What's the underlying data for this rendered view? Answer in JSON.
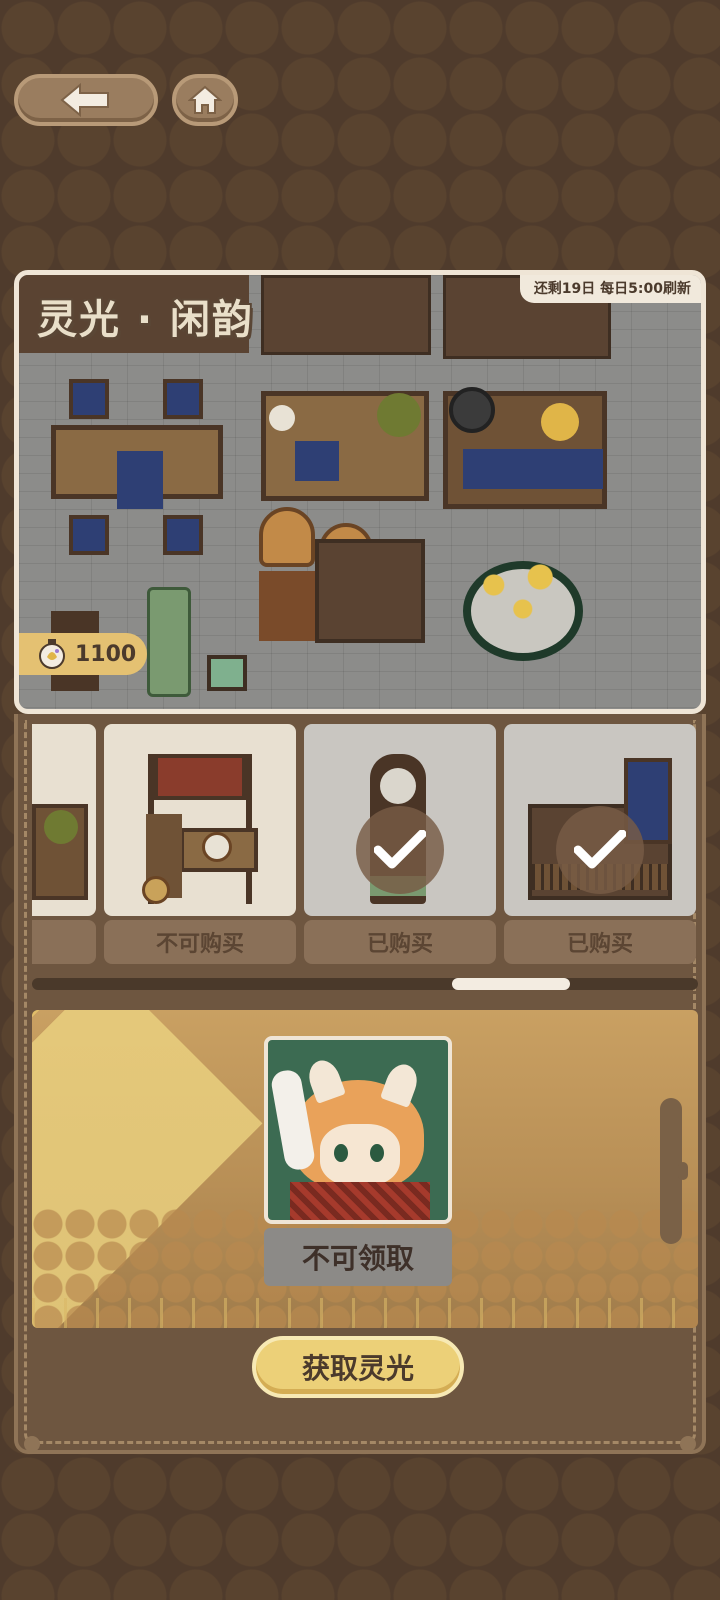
{
  "nav": {
    "back_icon": "arrow-left-icon",
    "home_icon": "home-icon"
  },
  "banner": {
    "title": "灵光 · 闲韵",
    "refresh_text": "还剩19日 每日5:00刷新",
    "currency_icon": "lantern-icon",
    "currency_amount": "1100"
  },
  "items": [
    {
      "label": "买",
      "status": "partial"
    },
    {
      "label": "不可购买",
      "status": "unavailable"
    },
    {
      "label": "已购买",
      "status": "purchased"
    },
    {
      "label": "已购买",
      "status": "purchased"
    }
  ],
  "reward": {
    "claim_label": "不可领取"
  },
  "actions": {
    "get_label": "获取灵光"
  },
  "colors": {
    "background": "#4f3b2c",
    "panel": "#6e5640",
    "accent_gold": "#ecd078",
    "card_light": "#e8e0d1",
    "card_gray": "#c9c6c1"
  }
}
